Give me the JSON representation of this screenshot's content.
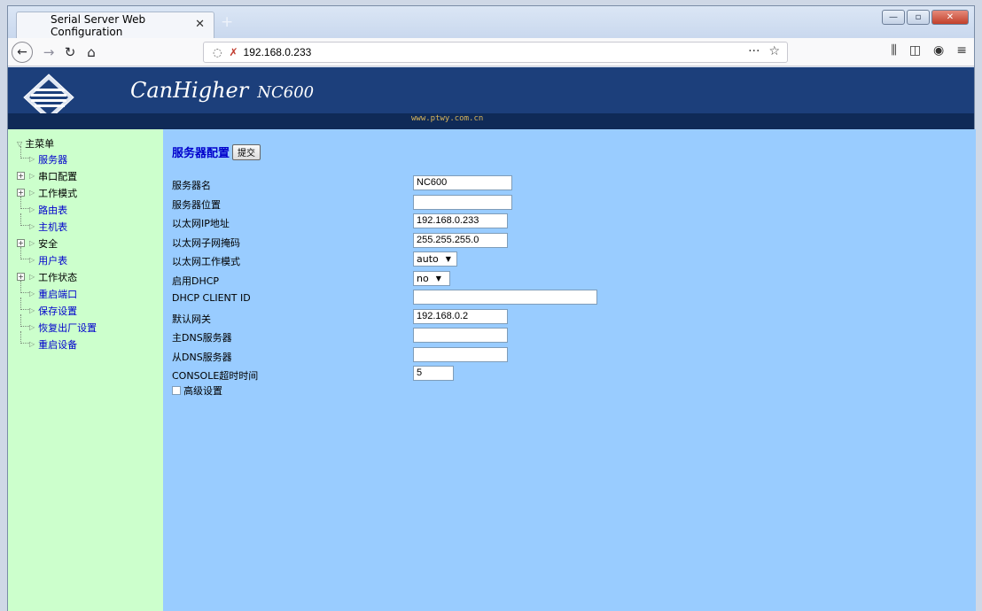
{
  "browser": {
    "tab_title": "Serial Server Web Configuration",
    "tab_close": "✕",
    "new_tab": "+",
    "url": "192.168.0.233",
    "url_more": "···",
    "win_min": "—",
    "win_max": "▫",
    "win_close": "✕"
  },
  "banner": {
    "brand": "CanHigher",
    "model": "NC600",
    "site": "www.ptwy.com.cn"
  },
  "sidebar": {
    "root": "主菜单",
    "items": [
      {
        "label": "服务器",
        "link": true,
        "expandable": false
      },
      {
        "label": "串口配置",
        "link": false,
        "expandable": true
      },
      {
        "label": "工作模式",
        "link": false,
        "expandable": true
      },
      {
        "label": "路由表",
        "link": true,
        "expandable": false
      },
      {
        "label": "主机表",
        "link": true,
        "expandable": false
      },
      {
        "label": "安全",
        "link": false,
        "expandable": true
      },
      {
        "label": "用户表",
        "link": true,
        "expandable": false
      },
      {
        "label": "工作状态",
        "link": false,
        "expandable": true
      },
      {
        "label": "重启端口",
        "link": true,
        "expandable": false
      },
      {
        "label": "保存设置",
        "link": true,
        "expandable": false
      },
      {
        "label": "恢复出厂设置",
        "link": true,
        "expandable": false
      },
      {
        "label": "重启设备",
        "link": true,
        "expandable": false
      }
    ]
  },
  "main": {
    "heading": "服务器配置",
    "submit": "提交",
    "fields": [
      {
        "label": "服务器名",
        "value": "NC600"
      },
      {
        "label": "服务器位置",
        "value": ""
      },
      {
        "label": "以太网IP地址",
        "value": "192.168.0.233"
      },
      {
        "label": "以太网子网掩码",
        "value": "255.255.255.0"
      },
      {
        "label": "以太网工作模式",
        "value": "auto"
      },
      {
        "label": "启用DHCP",
        "value": "no"
      },
      {
        "label": "DHCP CLIENT ID",
        "value": ""
      },
      {
        "label": "默认网关",
        "value": "192.168.0.2"
      },
      {
        "label": "主DNS服务器",
        "value": ""
      },
      {
        "label": "从DNS服务器",
        "value": ""
      },
      {
        "label": "CONSOLE超时时间",
        "value": "5"
      }
    ],
    "advanced_label": "高级设置",
    "advanced_checked": false
  }
}
